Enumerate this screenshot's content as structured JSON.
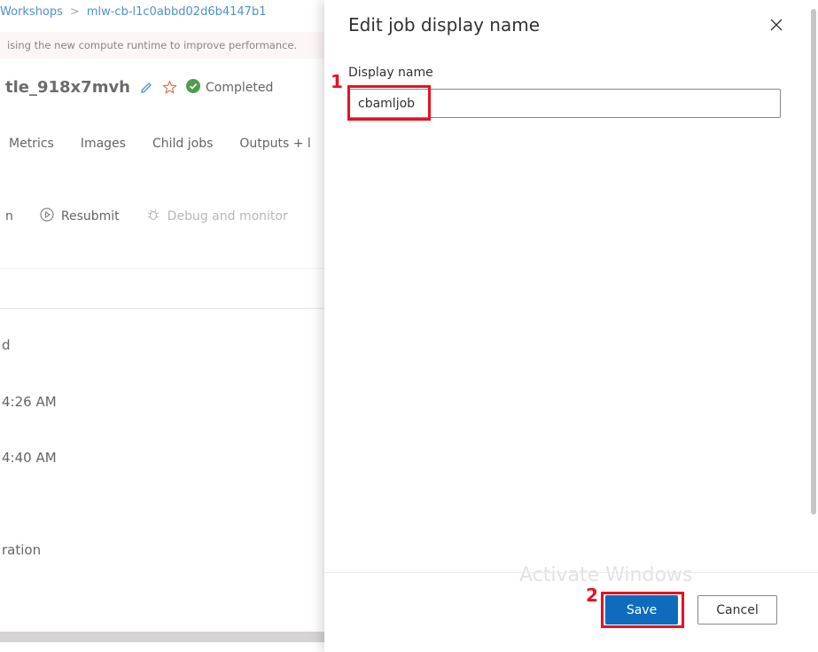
{
  "background": {
    "breadcrumb": [
      "Workshops",
      "mlw-cb-l1c0abbd02d6b4147b1"
    ],
    "banner": "ising the new compute runtime to improve performance.",
    "job_title": "tle_918x7mvh",
    "status": "Completed",
    "tabs": [
      "Metrics",
      "Images",
      "Child jobs",
      "Outputs + l"
    ],
    "toolbar": {
      "partial_item": "n",
      "resubmit": "Resubmit",
      "debug": "Debug and monitor"
    },
    "details": [
      "d",
      "4:26 AM",
      "4:40 AM",
      "ration"
    ]
  },
  "panel": {
    "title": "Edit job display name",
    "field_label": "Display name",
    "field_value": "cbamljob",
    "save_label": "Save",
    "cancel_label": "Cancel",
    "watermark": "Activate Windows"
  },
  "annotations": {
    "callout_1": "1",
    "callout_2": "2"
  },
  "colors": {
    "accent": "#0f6cbd",
    "success": "#107c10",
    "callout": "#e81123",
    "star": "#d83b01"
  }
}
